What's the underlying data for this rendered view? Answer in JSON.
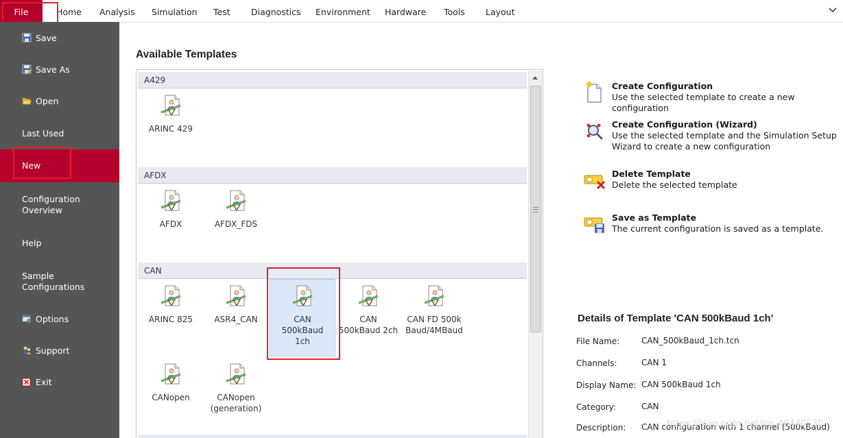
{
  "menu": {
    "file": "File",
    "tabs": [
      "Home",
      "Analysis",
      "Simulation",
      "Test",
      "Diagnostics",
      "Environment",
      "Hardware",
      "Tools",
      "Layout"
    ]
  },
  "sidebar": {
    "items": [
      {
        "label": "Save",
        "icon": "floppy-disk-icon"
      },
      {
        "label": "Save As",
        "icon": "floppy-disk-save-as-icon"
      },
      {
        "label": "Open",
        "icon": "open-folder-icon"
      },
      {
        "label": "Last Used"
      },
      {
        "label": "New",
        "selected": true
      },
      {
        "label": "Configuration Overview"
      },
      {
        "label": "Help"
      },
      {
        "label": "Sample Configurations"
      },
      {
        "label": "Options",
        "icon": "options-icon"
      },
      {
        "label": "Support",
        "icon": "support-icon"
      },
      {
        "label": "Exit",
        "icon": "exit-icon"
      }
    ]
  },
  "templates": {
    "heading": "Available Templates",
    "groups": [
      {
        "name": "A429",
        "items": [
          "ARINC 429"
        ]
      },
      {
        "name": "AFDX",
        "items": [
          "AFDX",
          "AFDX_FDS"
        ]
      },
      {
        "name": "CAN",
        "items": [
          "ARINC 825",
          "ASR4_CAN",
          "CAN 500kBaud 1ch",
          "CAN 500kBaud 2ch",
          "CAN FD 500kBaud/4MBaud",
          "CANopen",
          "CANopen (generation)"
        ],
        "selected": "CAN 500kBaud 1ch"
      }
    ]
  },
  "actions": [
    {
      "title": "Create Configuration",
      "desc": "Use the selected template to create a new configuration",
      "icon": "new-document-icon"
    },
    {
      "title": "Create Configuration (Wizard)",
      "desc": "Use the selected template and the Simulation Setup Wizard to create a new configuration",
      "icon": "wizard-icon"
    },
    {
      "title": "Delete Template",
      "desc": "Delete the selected template",
      "icon": "delete-template-icon"
    },
    {
      "title": "Save as Template",
      "desc": "The current configuration is saved as a template.",
      "icon": "save-template-icon"
    }
  ],
  "details": {
    "title": "Details of Template 'CAN 500kBaud 1ch'",
    "rows": [
      {
        "label": "File Name:",
        "value": "CAN_500kBaud_1ch.tcn"
      },
      {
        "label": "Channels:",
        "value": "CAN 1"
      },
      {
        "label": "Display Name:",
        "value": "CAN 500kBaud 1ch"
      },
      {
        "label": "Category:",
        "value": "CAN"
      },
      {
        "label": "Description:",
        "value": "CAN configuration with 1 channel (500kBaud)"
      }
    ]
  },
  "watermark": "https://blog.csdn.net/qq_40440530",
  "colors": {
    "accent": "#b5002b",
    "sidebar": "#555555",
    "highlight": "#e0202a",
    "group_header": "#e6ebf2"
  }
}
